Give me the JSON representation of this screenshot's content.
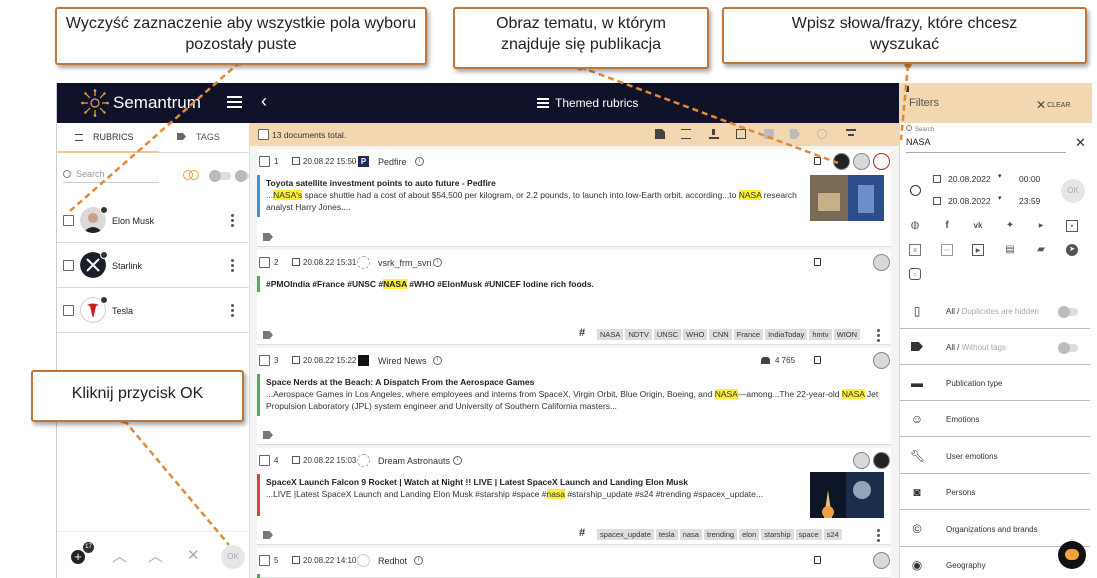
{
  "annotations": {
    "clear_selection": "Wyczyść zaznaczenie aby wszystkie pola wyboru pozostały puste",
    "topic_image": "Obraz tematu, w którym znajduje się publikacja",
    "type_words": "Wpisz słowa/frazy, które chcesz wyszukać",
    "click_ok": "Kliknij przycisk OK"
  },
  "header": {
    "brand": "Semantrum",
    "center_title": "Themed rubrics"
  },
  "sidebar": {
    "tabs": {
      "rubrics": "RUBRICS",
      "tags": "TAGS"
    },
    "search_placeholder": "Search",
    "rubrics": [
      {
        "name": "Elon Musk"
      },
      {
        "name": "Starlink"
      },
      {
        "name": "Tesla"
      }
    ],
    "badge_count": "17",
    "ok_label": "OK"
  },
  "toolbar": {
    "total": "13 documents total."
  },
  "documents": [
    {
      "num": "1",
      "date": "20.08.22 15:50",
      "source": "Pedfire",
      "title": "Toyota satellite investment points to auto future - Pedfire",
      "text_parts": [
        "...",
        "NASA's",
        " space shuttle had a cost of about $54,500 per kilogram, or 2.2 pounds, to launch into low-Earth orbit, according...to ",
        "NASA",
        " research"
      ],
      "text_line2": "analyst Harry Jones....",
      "bar_color": "#3a9ad9"
    },
    {
      "num": "2",
      "date": "20.08.22 15:31",
      "source": "vsrk_frm_svn",
      "title_parts": [
        "#PMOIndia #France #UNSC #",
        "NASA",
        " #WHO #ElonMusk #UNICEF Iodine rich foods."
      ],
      "tags": [
        "NASA",
        "NDTV",
        "UNSC",
        "WHO",
        "CNN",
        "France",
        "IndiaToday",
        "hmtv",
        "WION"
      ],
      "bar_color": "#4caf50"
    },
    {
      "num": "3",
      "date": "20.08.22 15:22",
      "source": "Wired News",
      "audience": "4 765",
      "title": "Space Nerds at the Beach: A Dispatch From the Aerospace Games",
      "text_parts": [
        "...Aerospace Games in Los Angeles, where employees and interns from SpaceX, Virgin Orbit, Blue Origin, Boeing, and ",
        "NASA",
        "—among...The 22-year-old ",
        "NASA",
        " Jet"
      ],
      "text_line2": "Propulsion Laboratory (JPL) system engineer and University of Southern California masters...",
      "bar_color": "#4caf50"
    },
    {
      "num": "4",
      "date": "20.08.22 15:03",
      "source": "Dream Astronauts",
      "title": "SpaceX Launch Falcon 9 Rocket | Watch at Night !! LIVE | Latest SpaceX Launch and Landing Elon Musk",
      "text_parts": [
        "...LIVE |Latest SpaceX Launch and Landing Elon Musk #starship #space #",
        "nasa",
        " #starship_update #s24 #trending #spacex_update..."
      ],
      "tags": [
        "spacex_update",
        "tesla",
        "nasa",
        "trending",
        "elon",
        "starship",
        "space",
        "s24"
      ],
      "bar_color": "#e04040"
    },
    {
      "num": "5",
      "date": "20.08.22 14:10",
      "source": "Redhot",
      "bar_color": "#4caf50"
    }
  ],
  "filters": {
    "title": "Filters",
    "clear": "CLEAR",
    "search_label": "Search",
    "search_value": "NASA",
    "date_from": "20.08.2022",
    "time_from": "00:00",
    "date_to": "20.08.2022",
    "time_to": "23:59",
    "ok_label": "OK",
    "items": [
      {
        "main": "All / ",
        "sub": "Duplicates are hidden"
      },
      {
        "main": "All / ",
        "sub": "Without tags"
      },
      {
        "main": "Publication type"
      },
      {
        "main": "Emotions"
      },
      {
        "main": "User emotions"
      },
      {
        "main": "Persons"
      },
      {
        "main": "Organizations and brands"
      },
      {
        "main": "Geography"
      }
    ]
  },
  "colors": {
    "topbar": "#10122a",
    "accent": "#f2d7b0",
    "highlight": "#ffee33",
    "callout_border": "#c0783a",
    "arrow": "#e2893a"
  }
}
